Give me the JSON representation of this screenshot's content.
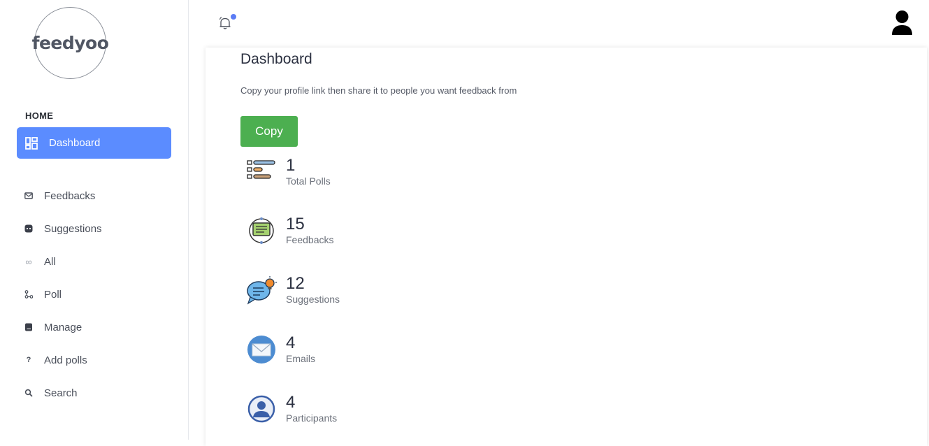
{
  "brand": {
    "logo_text": "feedyoo"
  },
  "sidebar": {
    "section_title": "HOME",
    "active_item": {
      "label": "Dashboard",
      "icon": "dashboard-icon"
    },
    "items": [
      {
        "label": "Feedbacks",
        "icon": "mail-icon"
      },
      {
        "label": "Suggestions",
        "icon": "chat-icon"
      },
      {
        "label": "All",
        "icon": "infinity-icon"
      },
      {
        "label": "Poll",
        "icon": "poll-icon"
      },
      {
        "label": "Manage",
        "icon": "book-icon"
      },
      {
        "label": "Add polls",
        "icon": "question-icon"
      },
      {
        "label": "Search",
        "icon": "search-icon"
      }
    ]
  },
  "header": {
    "notification_icon": "bell-icon",
    "avatar_icon": "user-icon"
  },
  "main": {
    "title": "Dashboard",
    "subtitle": "Copy your profile link then share it to people you want feedback from",
    "copy_label": "Copy",
    "stats": [
      {
        "value": "1",
        "label": "Total Polls",
        "icon": "poll-bars-icon"
      },
      {
        "value": "15",
        "label": "Feedbacks",
        "icon": "feedback-cycle-icon"
      },
      {
        "value": "12",
        "label": "Suggestions",
        "icon": "idea-chat-icon"
      },
      {
        "value": "4",
        "label": "Emails",
        "icon": "envelope-icon"
      },
      {
        "value": "4",
        "label": "Participants",
        "icon": "participant-icon"
      }
    ]
  },
  "colors": {
    "accent": "#5b8cff",
    "copy_button": "#4caf50",
    "notification_dot": "#5b7cf5"
  }
}
